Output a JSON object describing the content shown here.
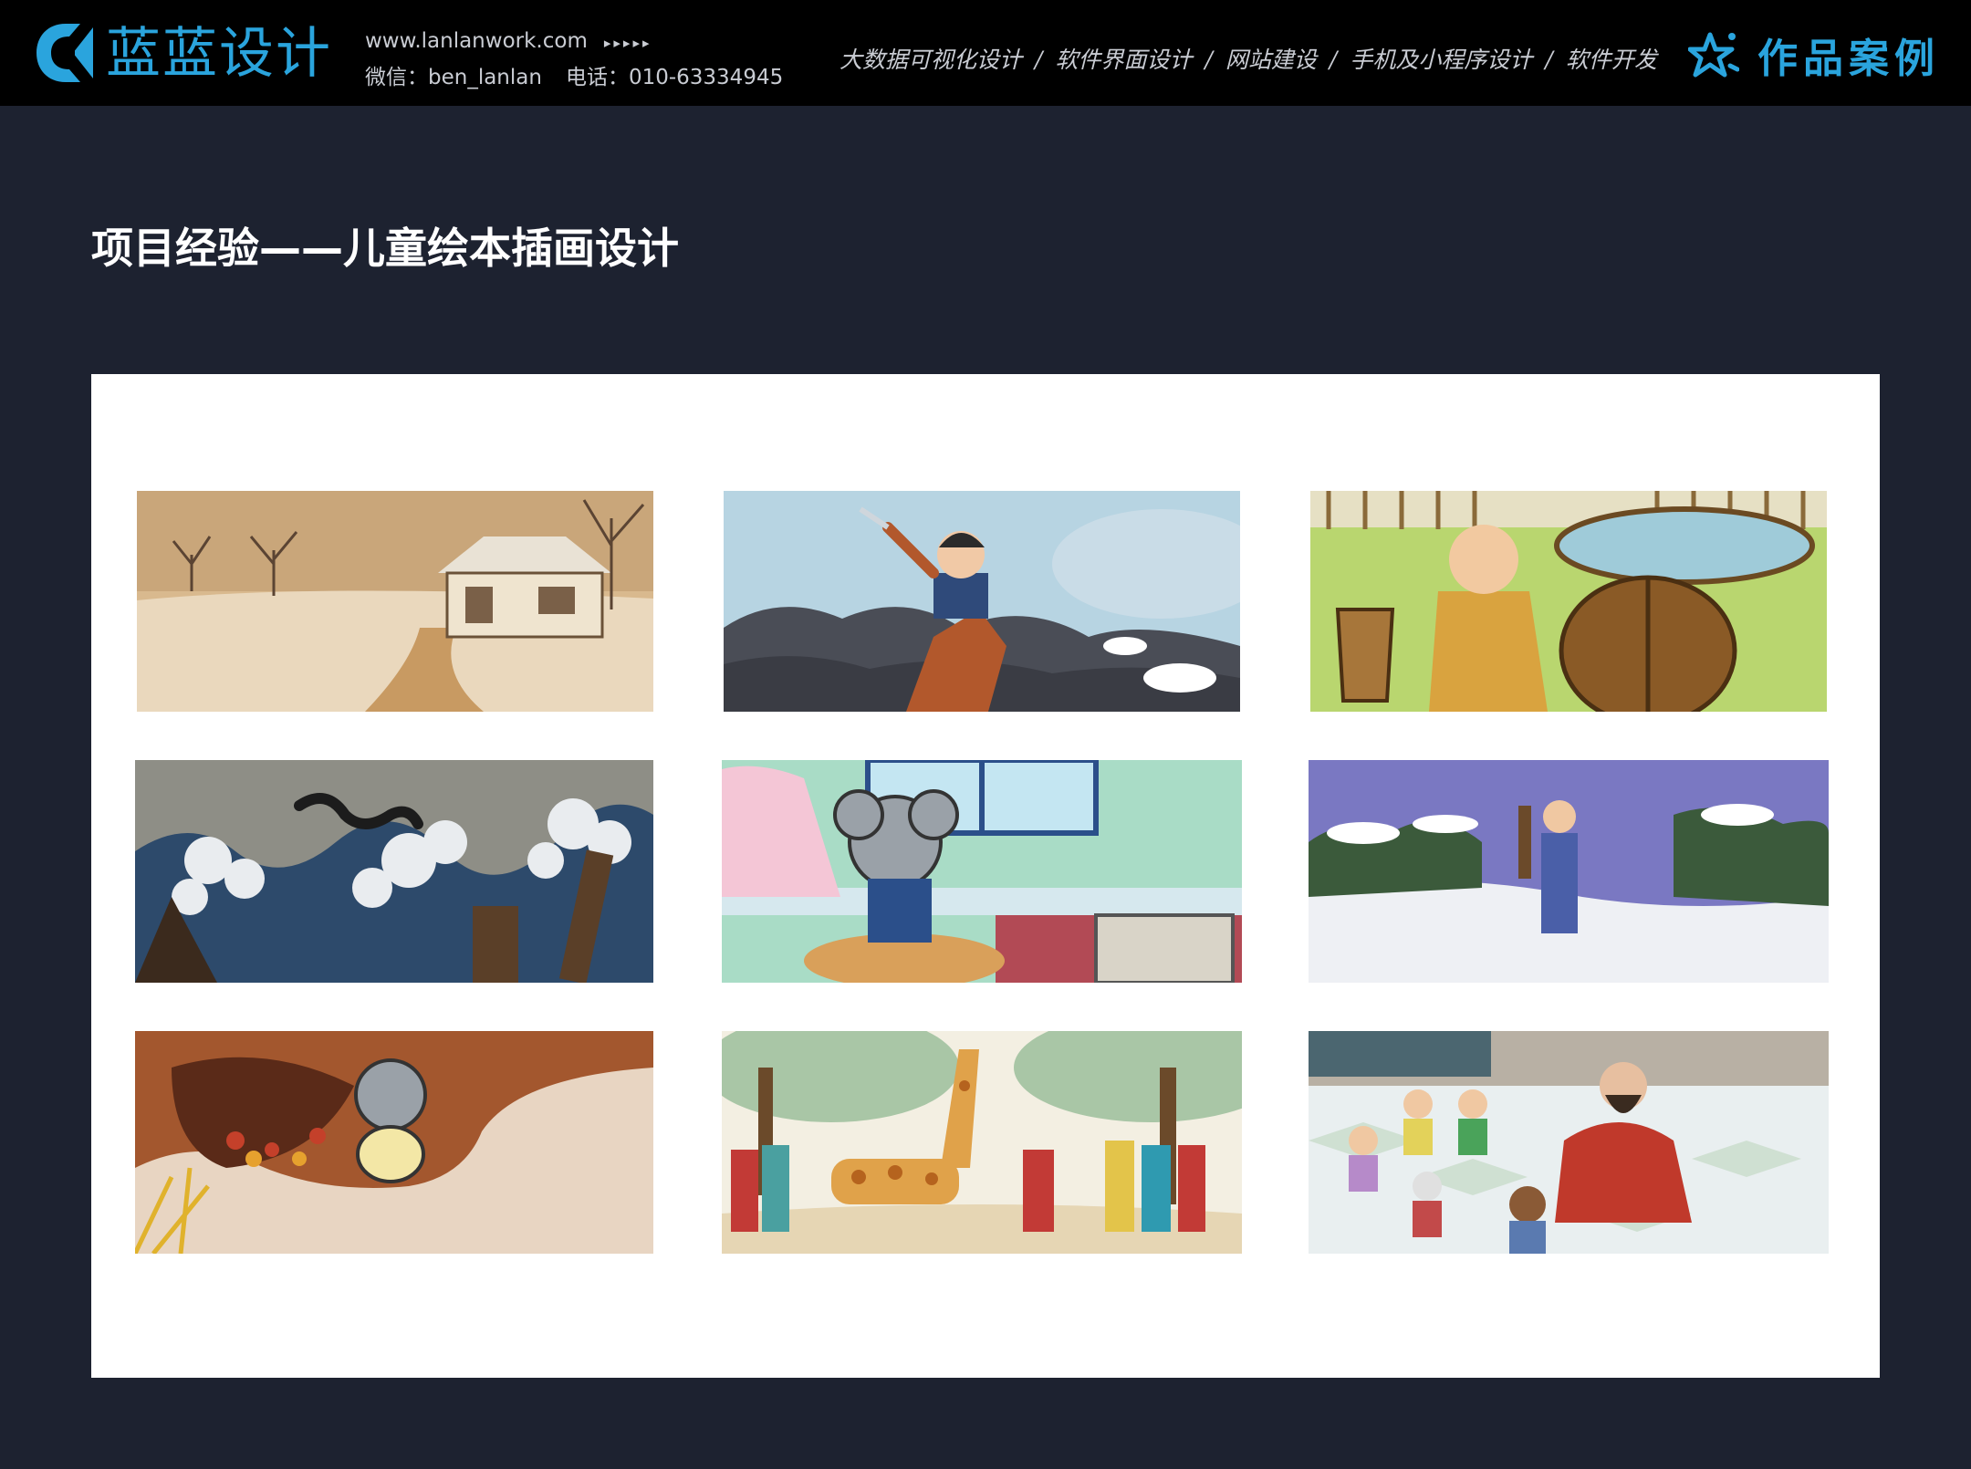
{
  "header": {
    "brand": "蓝蓝设计",
    "website": "www.lanlanwork.com",
    "arrows": "▸▸▸▸▸",
    "wechat": "微信：ben_lanlan",
    "phone": "电话：010-63334945",
    "services": [
      "大数据可视化设计",
      "软件界面设计",
      "网站建设",
      "手机及小程序设计",
      "软件开发"
    ],
    "separator": "/",
    "cases_label": "作品案例"
  },
  "page": {
    "title": "项目经验——儿童绘本插画设计"
  },
  "colors": {
    "header_bg": "#000000",
    "page_bg": "#1d2230",
    "accent": "#2aa4dd",
    "panel_bg": "#ffffff"
  },
  "icons": {
    "logo": "brand-logo-icon",
    "cases": "sparkle-star-icon"
  },
  "gallery": [
    {
      "name": "snowy-farmhouse-illustration"
    },
    {
      "name": "running-warrior-illustration"
    },
    {
      "name": "monk-water-barrel-illustration"
    },
    {
      "name": "dragon-waves-illustration"
    },
    {
      "name": "mouse-cake-kitchen-illustration"
    },
    {
      "name": "traveler-snow-illustration"
    },
    {
      "name": "mouse-autumn-burrow-illustration"
    },
    {
      "name": "giraffe-procession-illustration"
    },
    {
      "name": "storyteller-children-illustration"
    }
  ]
}
